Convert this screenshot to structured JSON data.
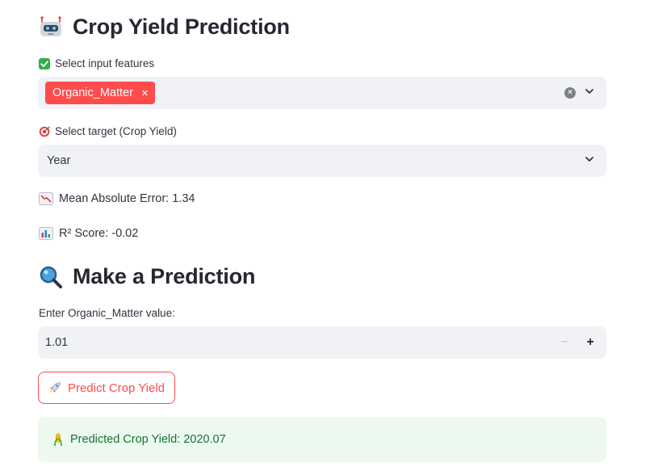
{
  "header": {
    "title": "Crop Yield Prediction",
    "icon": "robot-icon"
  },
  "features": {
    "label": "Select input features",
    "icon": "check-box-icon",
    "selected": [
      "Organic_Matter"
    ],
    "chip_remove": "×",
    "clear": "×",
    "dropdown_icon": "chevron-down-icon"
  },
  "target": {
    "label": "Select target (Crop Yield)",
    "icon": "target-icon",
    "value": "Year",
    "dropdown_icon": "chevron-down-icon"
  },
  "metrics": {
    "mae": "Mean Absolute Error: 1.34",
    "mae_icon": "chart-decreasing-icon",
    "r2": "R² Score: -0.02",
    "r2_icon": "bar-chart-icon"
  },
  "prediction": {
    "title": "Make a Prediction",
    "icon": "magnifying-glass-icon",
    "input_label": "Enter Organic_Matter value:",
    "input_value": "1.01",
    "minus": "−",
    "plus": "+",
    "button": "Predict Crop Yield",
    "button_icon": "rocket-icon",
    "result": "Predicted Crop Yield: 2020.07",
    "result_icon": "corn-icon"
  },
  "colors": {
    "primary": "#ff4b4b",
    "field_bg": "#f0f2f6",
    "success_bg": "#ecf9ef",
    "success_text": "#177233"
  }
}
